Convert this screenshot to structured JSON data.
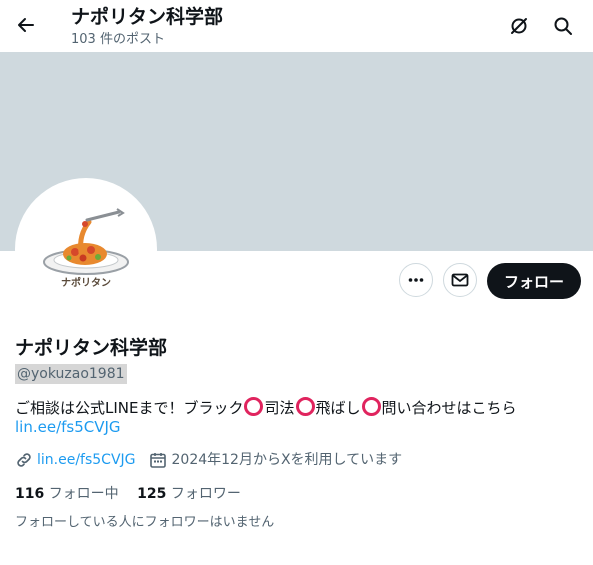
{
  "header": {
    "title": "ナポリタン科学部",
    "post_count": "103 件のポスト"
  },
  "profile": {
    "display_name": "ナポリタン科学部",
    "handle": "@yokuzao1981",
    "bio_parts": [
      "ご相談は公式LINEまで！ブラック",
      "司法",
      "飛ばし",
      "問い合わせはこちら"
    ],
    "bio_link": "lin.ee/fs5CVJG",
    "website": "lin.ee/fs5CVJG",
    "joined": "2024年12月からXを利用しています",
    "following_count": "116",
    "following_label": "フォロー中",
    "followers_count": "125",
    "followers_label": "フォロワー",
    "no_followers_note": "フォローしている人にフォロワーはいません",
    "avatar_caption": "ナポリタン"
  },
  "actions": {
    "follow_label": "フォロー"
  },
  "colors": {
    "banner": "#cfd9de",
    "link": "#1d9bf0",
    "circle_emoji": "#e0245e",
    "follow_button": "#0f1419"
  },
  "icons": [
    "back-arrow-icon",
    "grok-icon",
    "search-icon",
    "more-icon",
    "mail-icon",
    "link-icon",
    "calendar-icon",
    "hollow-red-circle-icon"
  ]
}
